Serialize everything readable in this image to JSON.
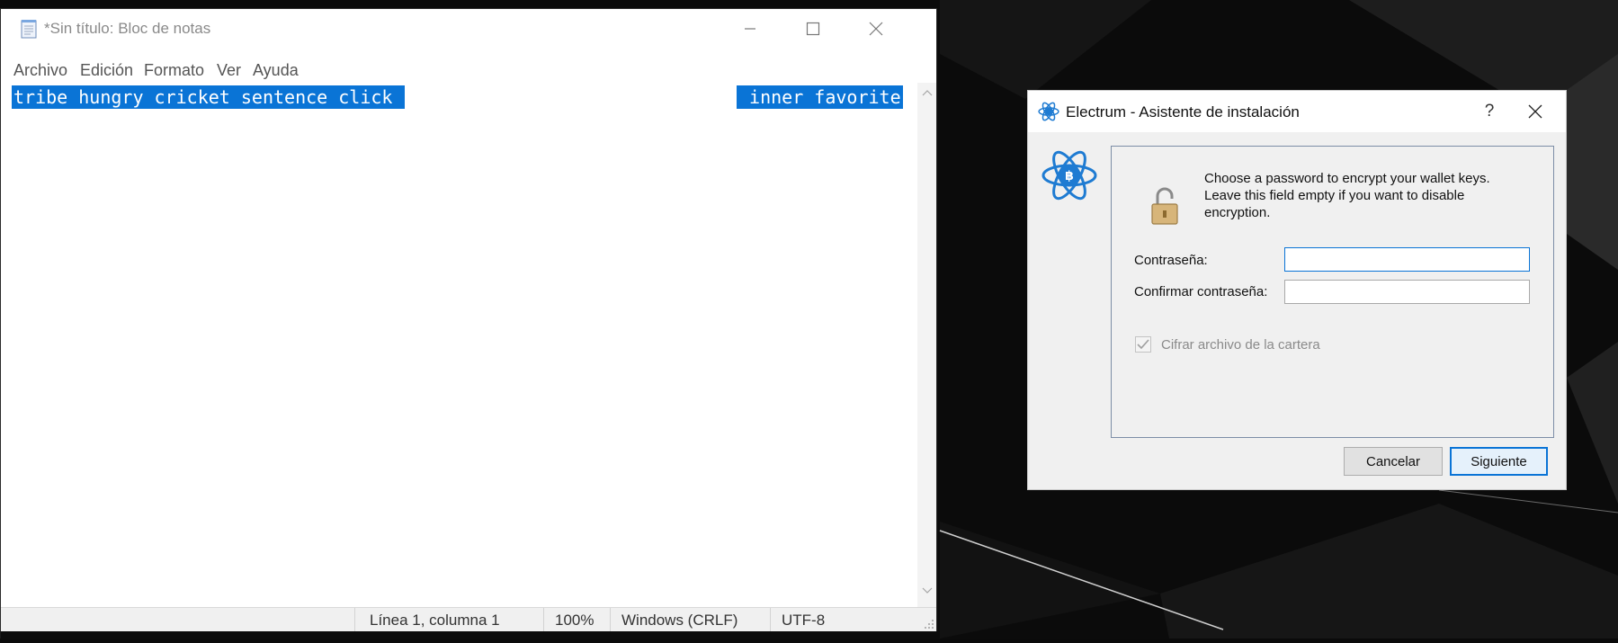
{
  "notepad": {
    "title": "*Sin título: Bloc de notas",
    "menu": [
      "Archivo",
      "Edición",
      "Formato",
      "Ver",
      "Ayuda"
    ],
    "selected_text_left": "tribe hungry cricket sentence click ",
    "selected_text_right": " inner favorite",
    "status": {
      "position": "Línea 1, columna 1",
      "zoom": "100%",
      "line_ending": "Windows (CRLF)",
      "encoding": "UTF-8"
    },
    "icons": {
      "app": "notepad-icon",
      "minimize": "minimize-icon",
      "maximize": "maximize-icon",
      "close": "close-icon"
    }
  },
  "electrum": {
    "title": "Electrum  -  Asistente de instalación",
    "help": "?",
    "message_lines": [
      "Choose a password to encrypt your wallet keys.",
      "Leave this field empty if you want to disable",
      "encryption."
    ],
    "password_label": "Contraseña:",
    "confirm_label": "Confirmar contraseña:",
    "password_value": "",
    "confirm_value": "",
    "encrypt_file_label": "Cifrar archivo de la cartera",
    "encrypt_file_checked": true,
    "encrypt_file_disabled": true,
    "cancel_label": "Cancelar",
    "next_label": "Siguiente",
    "icons": {
      "app": "electrum-icon",
      "logo": "electrum-logo-icon",
      "lock": "lock-icon",
      "close": "close-icon"
    }
  },
  "colors": {
    "selection": "#0a74d6",
    "electrum_blue": "#1e7bd2",
    "focus_border": "#0a74d6",
    "desktop": "#0a0a0a"
  }
}
